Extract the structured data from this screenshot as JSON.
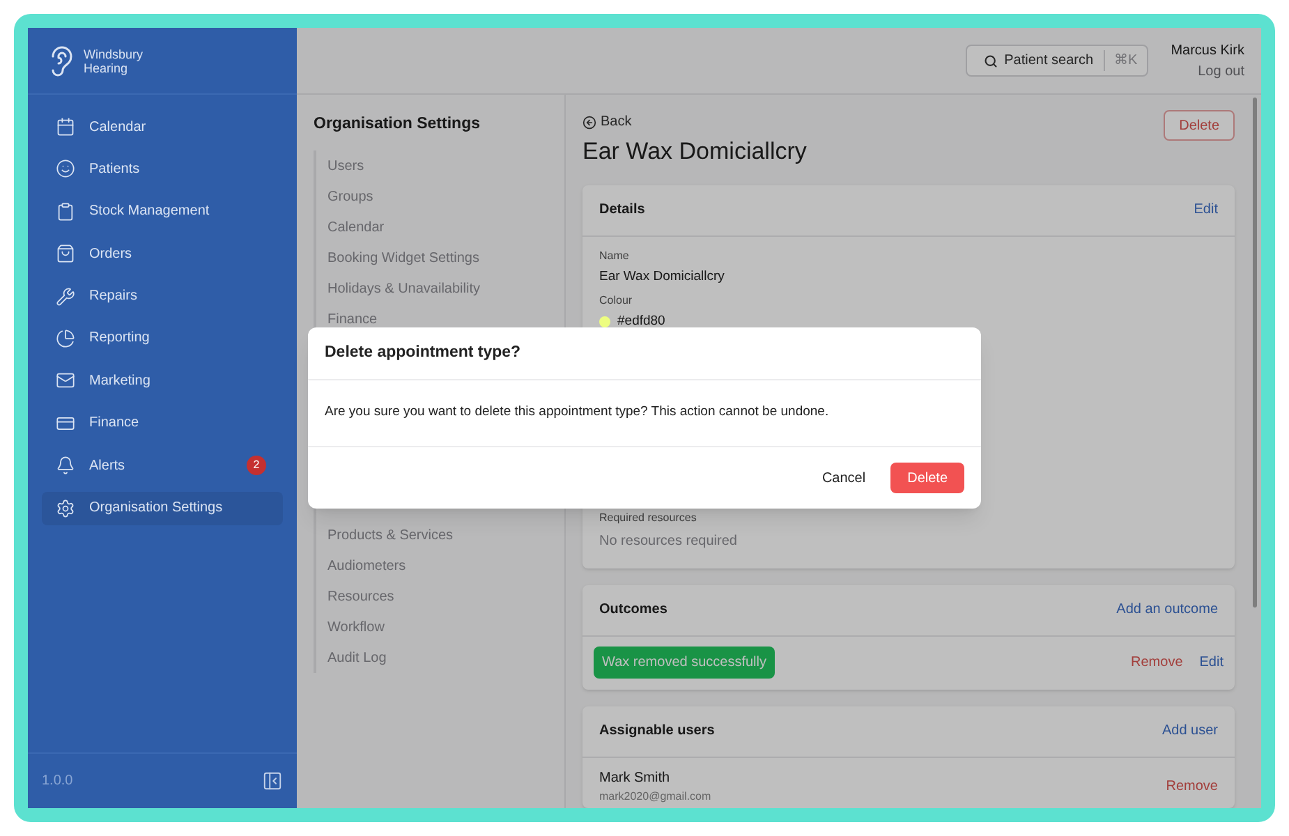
{
  "brand": {
    "line1": "Windsbury",
    "line2": "Hearing"
  },
  "sidebar": {
    "items": [
      {
        "kind": "calendar",
        "label": "Calendar",
        "selected": false
      },
      {
        "kind": "patients",
        "label": "Patients",
        "selected": false
      },
      {
        "kind": "stock",
        "label": "Stock Management",
        "selected": false
      },
      {
        "kind": "orders",
        "label": "Orders",
        "selected": false
      },
      {
        "kind": "repairs",
        "label": "Repairs",
        "selected": false
      },
      {
        "kind": "reporting",
        "label": "Reporting",
        "selected": false
      },
      {
        "kind": "marketing",
        "label": "Marketing",
        "selected": false
      },
      {
        "kind": "finance",
        "label": "Finance",
        "selected": false
      },
      {
        "kind": "alerts",
        "label": "Alerts",
        "selected": false,
        "badge": "2"
      },
      {
        "kind": "settings",
        "label": "Organisation Settings",
        "selected": true
      }
    ],
    "version": "1.0.0"
  },
  "header": {
    "search": {
      "label": "Patient search",
      "shortcut": "⌘K"
    },
    "user": {
      "name": "Marcus Kirk",
      "logout": "Log out"
    }
  },
  "settings_nav": {
    "title": "Organisation Settings",
    "items_top": [
      "Users",
      "Groups",
      "Calendar",
      "Booking Widget Settings",
      "Holidays & Unavailability",
      "Finance"
    ],
    "items_bottom": [
      "Products & Services",
      "Audiometers",
      "Resources",
      "Workflow",
      "Audit Log"
    ]
  },
  "page": {
    "back": "Back",
    "title": "Ear Wax Domiciallcry",
    "delete": "Delete",
    "details": {
      "title": "Details",
      "edit": "Edit",
      "fields": [
        {
          "label": "Name",
          "value": "Ear Wax Domiciallcry"
        },
        {
          "label": "Colour",
          "value": "#edfd80",
          "color": "#edfd80"
        }
      ],
      "resources_label": "Required resources",
      "resources_value": "No resources required"
    },
    "outcomes": {
      "title": "Outcomes",
      "add": "Add an outcome",
      "items": [
        {
          "label": "Wax removed successfully",
          "remove": "Remove",
          "edit": "Edit"
        }
      ]
    },
    "users": {
      "title": "Assignable users",
      "add": "Add user",
      "items": [
        {
          "name": "Mark Smith",
          "email": "mark2020@gmail.com",
          "remove": "Remove"
        }
      ]
    }
  },
  "dialog": {
    "title": "Delete appointment type?",
    "message": "Are you sure you want to delete this appointment type? This action cannot be undone.",
    "cancel": "Cancel",
    "confirm": "Delete"
  }
}
